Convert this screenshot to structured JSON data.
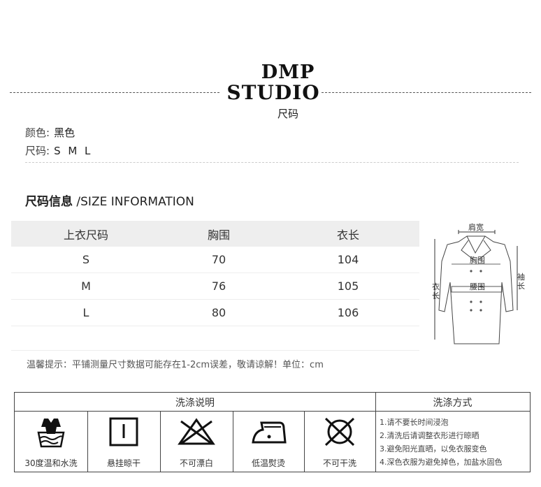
{
  "brand": {
    "line1": "DMP",
    "line2": "STUDIO",
    "subtitle": "尺码"
  },
  "product": {
    "color_label": "颜色:",
    "color_value": "黑色",
    "size_label": "尺码:",
    "size_value": "S M L"
  },
  "section": {
    "title_cn": "尺码信息",
    "title_en": "/SIZE INFORMATION"
  },
  "size_table": {
    "headers": [
      "上衣尺码",
      "胸围",
      "衣长"
    ],
    "rows": [
      [
        "S",
        "70",
        "104"
      ],
      [
        "M",
        "76",
        "105"
      ],
      [
        "L",
        "80",
        "106"
      ]
    ]
  },
  "diagram": {
    "shoulder": "肩宽",
    "chest": "胸围",
    "waist": "腰围",
    "length_1": "衣",
    "length_2": "长",
    "sleeve_1": "袖",
    "sleeve_2": "长"
  },
  "tip": "温馨提示：平铺测量尺寸数据可能存在1-2cm误差，敬请谅解！单位：cm",
  "care": {
    "header_left": "洗涤说明",
    "header_right": "洗涤方式",
    "icons": [
      {
        "icon": "hand-wash-icon",
        "label": "30度温和水洗"
      },
      {
        "icon": "hang-dry-icon",
        "label": "悬挂晾干"
      },
      {
        "icon": "no-bleach-icon",
        "label": "不可漂白"
      },
      {
        "icon": "low-iron-icon",
        "label": "低温熨烫"
      },
      {
        "icon": "no-dry-clean-icon",
        "label": "不可干洗"
      }
    ],
    "methods": [
      "1.请不要长时间浸泡",
      "2.清洗后请调整衣形进行晾晒",
      "3.避免阳光直晒，以免衣服变色",
      "4.深色衣服为避免掉色，加盐水固色"
    ]
  }
}
